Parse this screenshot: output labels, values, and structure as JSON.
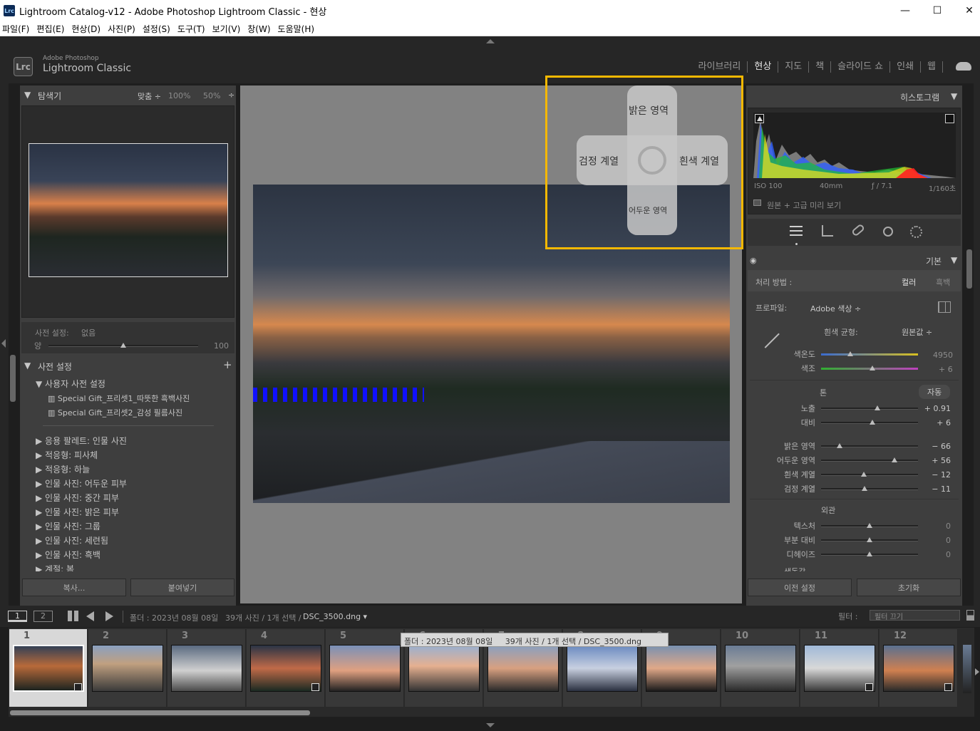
{
  "window": {
    "title": "Lightroom Catalog-v12 - Adobe Photoshop Lightroom Classic - 현상",
    "app_icon": "Lrc",
    "min": "—",
    "max": "☐",
    "close": "✕"
  },
  "menu": [
    "파일(F)",
    "편집(E)",
    "현상(D)",
    "사진(P)",
    "설정(S)",
    "도구(T)",
    "보기(V)",
    "창(W)",
    "도움말(H)"
  ],
  "identity": {
    "badge": "Lrc",
    "line1": "Adobe Photoshop",
    "line2": "Lightroom Classic"
  },
  "modules": [
    "라이브러리",
    "현상",
    "지도",
    "책",
    "슬라이드 쇼",
    "인쇄",
    "웹"
  ],
  "active_module": "현상",
  "navigator": {
    "title": "탐색기",
    "zoom_fit": "맞춤 ÷",
    "zoom_100": "100%",
    "zoom_50": "50%",
    "zoom_more": "÷"
  },
  "preset_amount": {
    "label": "사전 설정:",
    "value": "없음",
    "amount_label": "양",
    "amount": "100",
    "amount_fraction": 0.5
  },
  "presets": {
    "title": "사전 설정",
    "add": "+",
    "user_group": "사용자 사전 설정",
    "user_items": [
      "Special Gift_프리셋1_따뜻한 흑백사진",
      "Special Gift_프리셋2_감성 필름사진"
    ],
    "groups": [
      "응용 팔레트: 인물 사진",
      "적응형: 피사체",
      "적응형: 하늘",
      "인물 사진: 어두운 피부",
      "인물 사진: 중간 피부",
      "인물 사진: 밝은 피부",
      "인물 사진: 그룹",
      "인물 사진: 세련됨",
      "인물 사진: 흑백",
      "계절: 봄"
    ]
  },
  "left_buttons": {
    "copy": "복사...",
    "paste": "붙여넣기"
  },
  "overlay": {
    "highlights": "밝은 영역",
    "shadows": "어두운 영역",
    "blacks": "검정 계열",
    "whites": "흰색 계열"
  },
  "histogram": {
    "title": "히스토그램",
    "iso": "ISO 100",
    "focal": "40mm",
    "aperture": "ƒ / 7.1",
    "shutter": "1/160초",
    "preview_label": "원본 + 고급 미리 보기"
  },
  "tools": [
    "sliders-icon",
    "crop-icon",
    "heal-icon",
    "redeye-icon",
    "mask-icon"
  ],
  "basic": {
    "title": "기본",
    "treatment_label": "처리 방법 :",
    "color": "컬러",
    "bw": "흑백",
    "profile_label": "프로파일:",
    "profile_value": "Adobe 색상 ÷",
    "wb_label": "흰색 균형:",
    "wb_value": "원본값 ÷",
    "temp_label": "색온도",
    "temp_value": "4950",
    "temp_pos": 0.3,
    "tint_label": "색조",
    "tint_value": "+ 6",
    "tint_pos": 0.53,
    "tone_label": "톤",
    "auto": "자동",
    "tone": [
      {
        "label": "노출",
        "value": "+ 0.91",
        "pos": 0.58
      },
      {
        "label": "대비",
        "value": "+ 6",
        "pos": 0.53
      }
    ],
    "tone2": [
      {
        "label": "밝은 영역",
        "value": "− 66",
        "pos": 0.19
      },
      {
        "label": "어두운 영역",
        "value": "+ 56",
        "pos": 0.76
      },
      {
        "label": "흰색 계열",
        "value": "− 12",
        "pos": 0.44
      },
      {
        "label": "검정 계열",
        "value": "− 11",
        "pos": 0.45
      }
    ],
    "presence_label": "외관",
    "presence": [
      {
        "label": "텍스처",
        "value": "0",
        "pos": 0.5
      },
      {
        "label": "부분 대비",
        "value": "0",
        "pos": 0.5
      },
      {
        "label": "디헤이즈",
        "value": "0",
        "pos": 0.5
      }
    ],
    "cut_label": "생동감"
  },
  "right_buttons": {
    "prev": "이전 설정",
    "reset": "초기화"
  },
  "filmstrip_bar": {
    "v1": "1",
    "v2": "2",
    "source": "폴더 : 2023년 08월 08일",
    "count": "39개 사진 / 1개 선택 /",
    "file": "DSC_3500.dng ▾",
    "filter_label": "필터 :",
    "filter_value": "필터 끄기"
  },
  "tooltip": {
    "a": "폴더 : 2023년 08월 08일",
    "b": "39개 사진 / 1개 선택 / DSC_3500.dng"
  },
  "filmstrip": [
    "1",
    "2",
    "3",
    "4",
    "5",
    "6",
    "7",
    "8",
    "9",
    "10",
    "11",
    "12"
  ],
  "colors": {
    "accent": "#f5b800",
    "bg": "#3e3e3e",
    "dark": "#1e1e1e"
  }
}
